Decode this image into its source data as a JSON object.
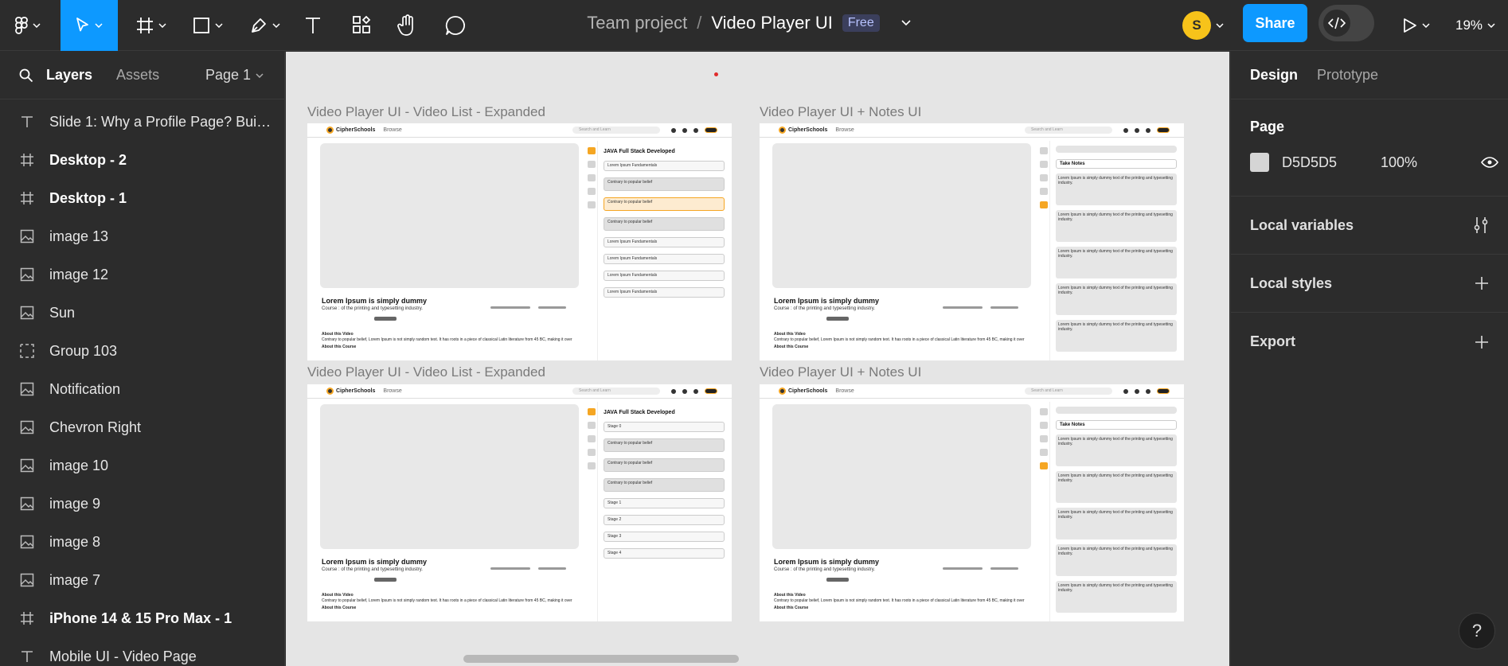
{
  "toolbar": {
    "file_project": "Team project",
    "file_separator": "/",
    "file_name": "Video Player UI",
    "plan_badge": "Free",
    "avatar_initial": "S",
    "share_label": "Share",
    "zoom": "19%",
    "accent_color": "#0d99ff",
    "tools": [
      "menu-icon",
      "move-icon",
      "frame-icon",
      "rectangle-icon",
      "pen-icon",
      "text-icon",
      "resources-icon",
      "hand-icon",
      "comment-icon"
    ]
  },
  "left_panel": {
    "tabs": {
      "layers": "Layers",
      "assets": "Assets"
    },
    "page_selector": "Page 1",
    "layers": [
      {
        "label": "Slide 1: Why a Profile Page? Build ...",
        "icon": "text-icon",
        "bold": false
      },
      {
        "label": "Desktop - 2",
        "icon": "frame-icon",
        "bold": true
      },
      {
        "label": "Desktop - 1",
        "icon": "frame-icon",
        "bold": true
      },
      {
        "label": "image 13",
        "icon": "image-icon",
        "bold": false
      },
      {
        "label": "image 12",
        "icon": "image-icon",
        "bold": false
      },
      {
        "label": "Sun",
        "icon": "image-icon",
        "bold": false
      },
      {
        "label": "Group 103",
        "icon": "group-icon",
        "bold": false
      },
      {
        "label": "Notification",
        "icon": "image-icon",
        "bold": false
      },
      {
        "label": "Chevron Right",
        "icon": "image-icon",
        "bold": false
      },
      {
        "label": "image 10",
        "icon": "image-icon",
        "bold": false
      },
      {
        "label": "image 9",
        "icon": "image-icon",
        "bold": false
      },
      {
        "label": "image 8",
        "icon": "image-icon",
        "bold": false
      },
      {
        "label": "image 7",
        "icon": "image-icon",
        "bold": false
      },
      {
        "label": "iPhone 14 & 15 Pro Max - 1",
        "icon": "frame-icon",
        "bold": true
      },
      {
        "label": "Mobile UI - Video Page",
        "icon": "text-icon",
        "bold": false
      }
    ]
  },
  "canvas": {
    "frames": [
      {
        "label": "Video Player UI - Video List - Expanded",
        "variant": "list"
      },
      {
        "label": "Video Player UI + Notes UI",
        "variant": "notes"
      },
      {
        "label": "Video Player UI - Video List - Expanded",
        "variant": "list2"
      },
      {
        "label": "Video Player UI + Notes UI",
        "variant": "notes"
      }
    ],
    "mock": {
      "brand": "CipherSchools",
      "browse": "Browse",
      "search": "Search and Learn",
      "video_title": "Lorem Ipsum is simply dummy",
      "course_line": "Course : of the printing and typesetting industry.",
      "about_video": "About this Video",
      "about_course": "About this Course",
      "about_text": "Contrary to popular belief, Lorem Ipsum is not simply random text. It has roots in a piece of classical Latin literature from 45 BC, making it over",
      "course_heading": "JAVA Full Stack Developed",
      "list_items": [
        "Lorem Ipsum Fundamentals",
        "Contrary to popular belief",
        "Contrary to popular belief",
        "Contrary to popular belief",
        "Lorem Ipsum Fundamentals",
        "Lorem Ipsum Fundamentals",
        "Lorem Ipsum Fundamentals",
        "Lorem Ipsum Fundamentals"
      ],
      "stage_items": [
        "Stage 0",
        "Contrary to popular belief",
        "Contrary to popular belief",
        "Contrary to popular belief",
        "Stage 1",
        "Stage 2",
        "Stage 3",
        "Stage 4"
      ],
      "notes_title": "Take Notes",
      "note_text": "Lorem Ipsum  is simply dummy text of the printing and typesetting industry."
    }
  },
  "right_panel": {
    "tabs": {
      "design": "Design",
      "prototype": "Prototype"
    },
    "page_section": "Page",
    "page_fill_hex": "D5D5D5",
    "page_fill_opacity": "100%",
    "page_fill_color": "#d5d5d5",
    "local_variables": "Local variables",
    "local_styles": "Local styles",
    "export": "Export"
  },
  "help": "?"
}
